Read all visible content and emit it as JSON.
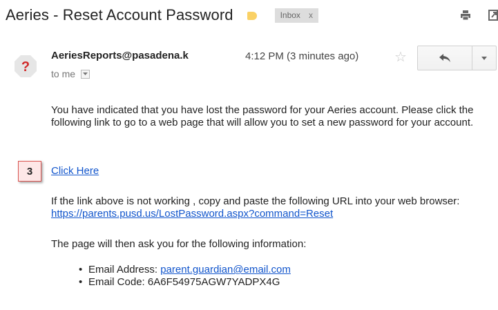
{
  "email": {
    "subject": "Aeries - Reset Account Password",
    "label_color": "#fad165",
    "inbox_chip": {
      "label": "Inbox",
      "close": "x"
    },
    "sender": "AeriesReports@pasadena.k",
    "recipient_label": "to me",
    "time": "4:12 PM (3 minutes ago)",
    "body": {
      "paragraph1": "You have indicated that you have lost the password for your Aeries account. Please click the following link to go to a web page that will allow you to set a new password for your account.",
      "link_text": "Click Here",
      "paragraph2": "If the link above is not working , copy and paste the following URL into your web browser:",
      "url": "https://parents.pusd.us/LostPassword.aspx?command=Reset",
      "paragraph3": "The page will then ask you for the following information:",
      "email_address_label": "Email Address: ",
      "email_address_value": "parent.guardian@email.com",
      "email_code_label": "Email Code: ",
      "email_code_value": "6A6F54975AGW7YADPX4G"
    }
  },
  "annotation": {
    "step_number": "3"
  },
  "icons": {
    "avatar": "question-mark-avatar-icon",
    "star": "star-outline-icon",
    "reply": "reply-arrow-icon",
    "more": "chevron-down-icon",
    "print": "print-icon",
    "new_window": "new-window-icon"
  }
}
